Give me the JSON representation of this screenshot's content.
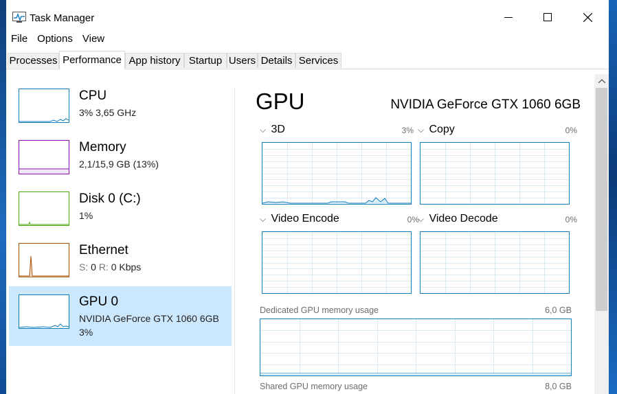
{
  "window": {
    "title": "Task Manager"
  },
  "menu": [
    "File",
    "Options",
    "View"
  ],
  "tabs": [
    "Processes",
    "Performance",
    "App history",
    "Startup",
    "Users",
    "Details",
    "Services"
  ],
  "active_tab": "Performance",
  "sidebar": {
    "items": [
      {
        "name": "CPU",
        "line1": "3% 3,65 GHz",
        "color": "#117dbb"
      },
      {
        "name": "Memory",
        "line1": "2,1/15,9 GB (13%)",
        "color": "#8b12ae"
      },
      {
        "name": "Disk 0 (C:)",
        "line1": "1%",
        "color": "#4da60c"
      },
      {
        "name": "Ethernet",
        "line1_prefix_s": "S:",
        "line1_s": "0",
        "line1_prefix_r": "R:",
        "line1_r": "0 Kbps",
        "color": "#a74f01"
      },
      {
        "name": "GPU 0",
        "line1": "NVIDIA GeForce GTX 1060 6GB",
        "line2": "3%",
        "color": "#117dbb",
        "selected": true
      }
    ]
  },
  "main": {
    "title": "GPU",
    "model": "NVIDIA GeForce GTX 1060 6GB",
    "engines": [
      {
        "label": "3D",
        "percent": "3%"
      },
      {
        "label": "Copy",
        "percent": "0%"
      },
      {
        "label": "Video Encode",
        "percent": "0%"
      },
      {
        "label": "Video Decode",
        "percent": "0%"
      }
    ],
    "dedicated_label": "Dedicated GPU memory usage",
    "dedicated_max": "6,0 GB",
    "shared_label": "Shared GPU memory usage",
    "shared_max": "8,0 GB"
  },
  "colors": {
    "accent": "#117dbb",
    "selected_bg": "#cce8ff",
    "grid": "#d9eaf4"
  },
  "icons": {
    "app": "task-manager-icon",
    "minimize": "minimize-icon",
    "maximize": "maximize-icon",
    "close": "close-icon",
    "chevron": "chevron-down-icon",
    "scroll_up": "chevron-up-icon"
  }
}
